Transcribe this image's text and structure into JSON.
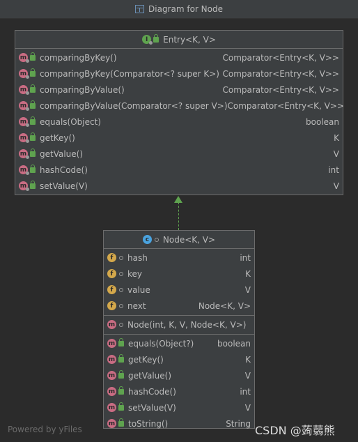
{
  "window": {
    "title": "Diagram for Node",
    "icon": "diagram-icon"
  },
  "entry": {
    "title": "Entry<K, V>",
    "kind": "interface",
    "methods": [
      {
        "name": "comparingByKey()",
        "type": "Comparator<Entry<K, V>>"
      },
      {
        "name": "comparingByKey(Comparator<? super K>)",
        "type": "Comparator<Entry<K, V>>"
      },
      {
        "name": "comparingByValue()",
        "type": "Comparator<Entry<K, V>>"
      },
      {
        "name": "comparingByValue(Comparator<? super V>)",
        "type": "Comparator<Entry<K, V>>"
      },
      {
        "name": "equals(Object)",
        "type": "boolean"
      },
      {
        "name": "getKey()",
        "type": "K"
      },
      {
        "name": "getValue()",
        "type": "V"
      },
      {
        "name": "hashCode()",
        "type": "int"
      },
      {
        "name": "setValue(V)",
        "type": "V"
      }
    ]
  },
  "node": {
    "title": "Node<K, V>",
    "kind": "class",
    "fields": [
      {
        "name": "hash",
        "type": "int"
      },
      {
        "name": "key",
        "type": "K"
      },
      {
        "name": "value",
        "type": "V"
      },
      {
        "name": "next",
        "type": "Node<K, V>"
      }
    ],
    "constructor": {
      "name": "Node(int, K, V, Node<K, V>)"
    },
    "methods": [
      {
        "name": "equals(Object?)",
        "type": "boolean"
      },
      {
        "name": "getKey()",
        "type": "K"
      },
      {
        "name": "getValue()",
        "type": "V"
      },
      {
        "name": "hashCode()",
        "type": "int"
      },
      {
        "name": "setValue(V)",
        "type": "V"
      },
      {
        "name": "toString()",
        "type": "String"
      }
    ]
  },
  "footer": {
    "left": "Powered by yFiles",
    "right": "CSDN @蒟蒻熊"
  },
  "colors": {
    "background": "#2b2b2b",
    "panel": "#3c3f41",
    "border": "#6b6b6b",
    "inherit": "#5fa34f"
  }
}
